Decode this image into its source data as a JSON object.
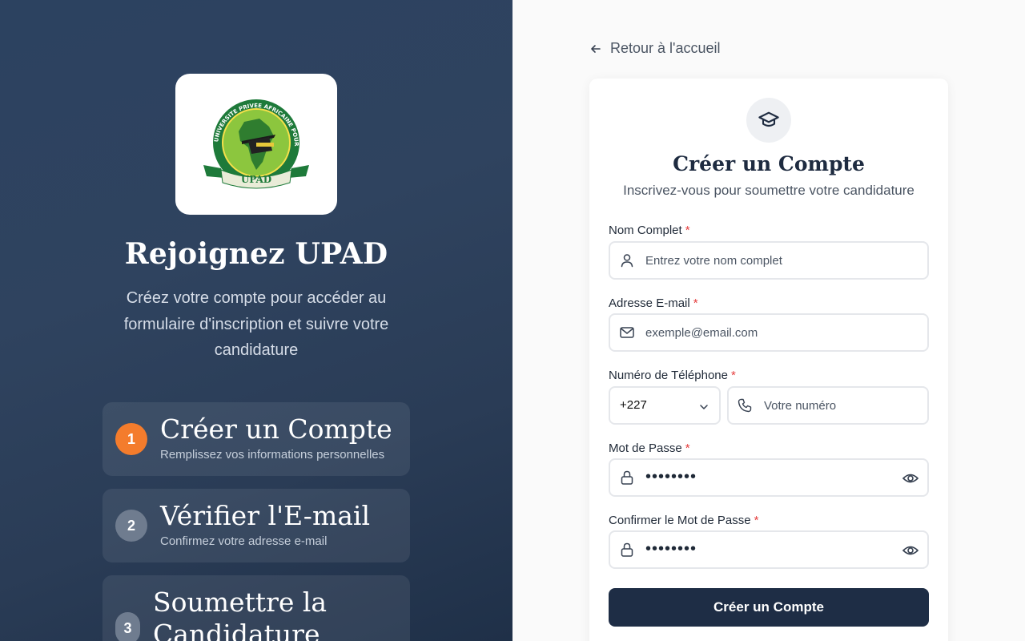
{
  "left": {
    "logo": {
      "text": "UPAD",
      "ring_text": "UNIVERSITE PRIVEE AFRICAINE POUR LE DEVELOPPEMENT"
    },
    "title": "Rejoignez UPAD",
    "description": "Créez votre compte pour accéder au formulaire d'inscription et suivre votre candidature",
    "steps": [
      {
        "number": "1",
        "title": "Créer un Compte",
        "subtitle": "Remplissez vos informations personnelles",
        "status": "active"
      },
      {
        "number": "2",
        "title": "Vérifier l'E-mail",
        "subtitle": "Confirmez votre adresse e-mail",
        "status": "pending"
      },
      {
        "number": "3",
        "title": "Soumettre la Candidature",
        "subtitle": "",
        "status": "pending"
      }
    ]
  },
  "back_link": {
    "label": "Retour à l'accueil",
    "icon": "arrow-left-icon"
  },
  "form": {
    "icon": "graduation-cap-icon",
    "title": "Créer un Compte",
    "subtitle": "Inscrivez-vous pour soumettre votre candidature",
    "required_marker": "*",
    "fields": {
      "full_name": {
        "label": "Nom Complet",
        "placeholder": "Entrez votre nom complet",
        "icon": "user-icon"
      },
      "email": {
        "label": "Adresse E-mail",
        "placeholder": "exemple@email.com",
        "icon": "mail-icon"
      },
      "phone": {
        "label": "Numéro de Téléphone",
        "country_code": "+227",
        "placeholder": "Votre numéro",
        "icon": "phone-icon"
      },
      "password": {
        "label": "Mot de Passe",
        "value": "••••••••",
        "icon": "lock-icon"
      },
      "confirm_password": {
        "label": "Confirmer le Mot de Passe",
        "value": "••••••••",
        "icon": "lock-icon"
      }
    },
    "submit_label": "Créer un Compte"
  },
  "colors": {
    "left_panel": "#2c4260",
    "accent_orange": "#f47c2c",
    "primary_button": "#1e2d45",
    "required": "#e53e3e"
  }
}
